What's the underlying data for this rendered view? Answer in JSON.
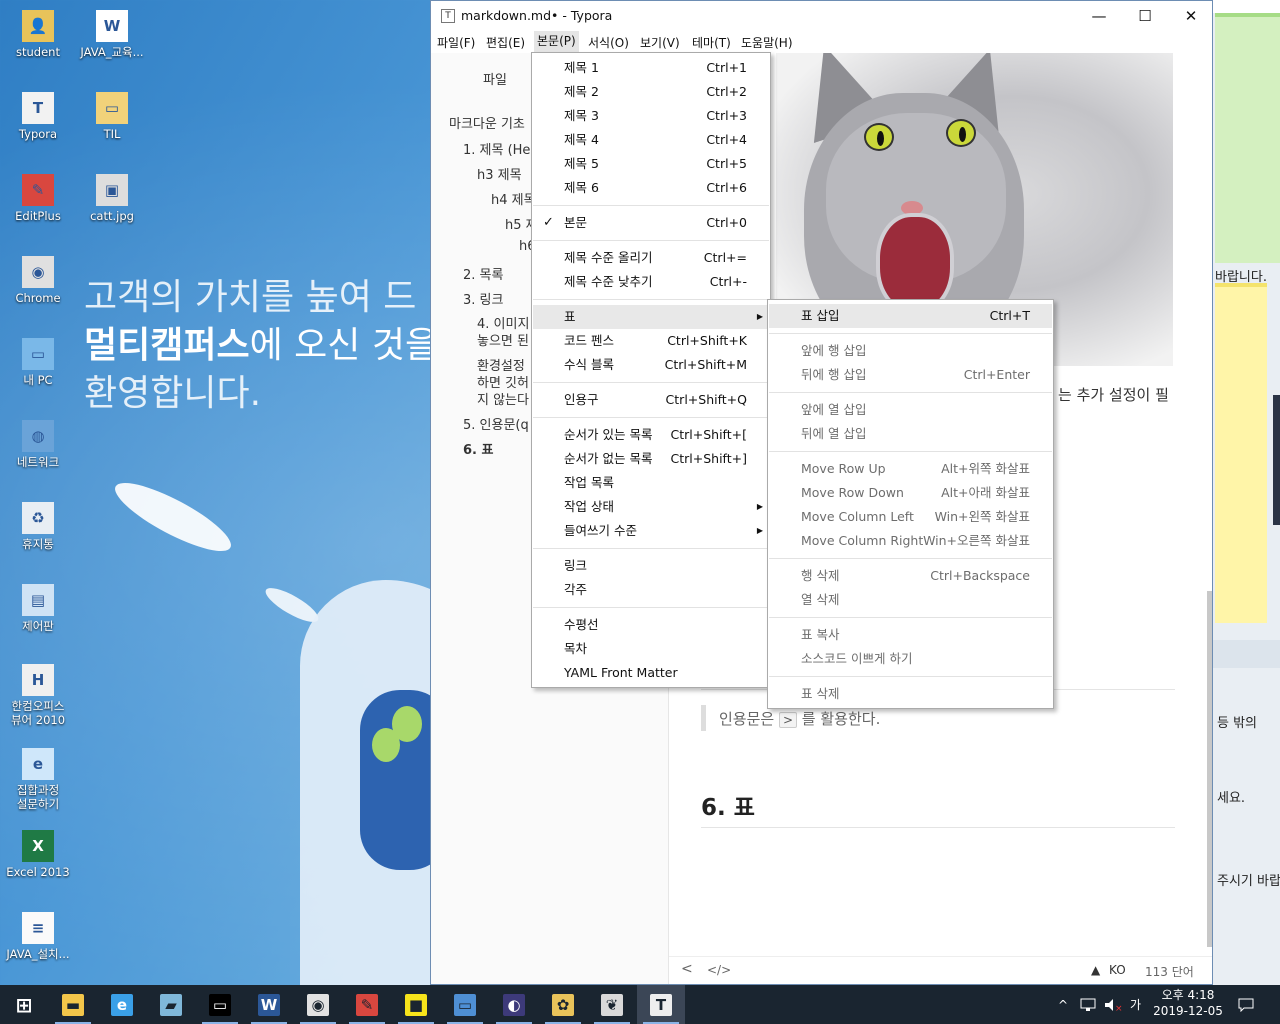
{
  "desktop": {
    "wallpaper_lines": {
      "line1": "고객의 가치를 높여 드",
      "line2_bold": "멀티캠퍼스",
      "line2_rest": "에 오신 것을",
      "line3": "환영합니다."
    },
    "icons": [
      {
        "label": "student",
        "icon": "user-folder-icon"
      },
      {
        "label": "JAVA_교육...",
        "icon": "word-document-icon"
      },
      {
        "label": "Typora",
        "icon": "typora-icon"
      },
      {
        "label": "TIL",
        "icon": "folder-icon"
      },
      {
        "label": "EditPlus",
        "icon": "editplus-icon"
      },
      {
        "label": "catt.jpg",
        "icon": "image-file-icon"
      },
      {
        "label": "Chrome",
        "icon": "chrome-icon"
      },
      {
        "label": "내 PC",
        "icon": "computer-icon"
      },
      {
        "label": "네트워크",
        "icon": "network-icon"
      },
      {
        "label": "휴지통",
        "icon": "recycle-bin-icon"
      },
      {
        "label": "제어판",
        "icon": "control-panel-icon"
      },
      {
        "label": "한컴오피스\n뷰어 2010",
        "icon": "hancom-viewer-icon"
      },
      {
        "label": "집합과정\n설문하기",
        "icon": "internet-explorer-icon"
      },
      {
        "label": "Excel 2013",
        "icon": "excel-icon"
      },
      {
        "label": "JAVA_설치...",
        "icon": "text-file-icon"
      }
    ]
  },
  "window": {
    "title": "markdown.md• - Typora",
    "controls": {
      "minimize": "—",
      "maximize": "☐",
      "close": "✕"
    },
    "menubar": [
      "파일(F)",
      "편집(E)",
      "본문(P)",
      "서식(O)",
      "보기(V)",
      "테마(T)",
      "도움말(H)"
    ],
    "active_menu": "본문(P)"
  },
  "sidebar": {
    "tab": "파일",
    "outline": [
      {
        "text": "마크다운 기초",
        "level": 0
      },
      {
        "text": "1. 제목 (He",
        "level": 1
      },
      {
        "text": "h3 제목",
        "level": 2
      },
      {
        "text": "h4 제목",
        "level": 3
      },
      {
        "text": "h5 제",
        "level": 4
      },
      {
        "text": "h6",
        "level": 5
      },
      {
        "text": "2. 목록",
        "level": 1
      },
      {
        "text": "3. 링크",
        "level": 1
      },
      {
        "text": "4. 이미지",
        "level": 2
      },
      {
        "text": "놓으면 된",
        "level": 2
      },
      {
        "text": "환경설정",
        "level": 2
      },
      {
        "text": "하면 깃허",
        "level": 2
      },
      {
        "text": "지 않는다",
        "level": 2
      },
      {
        "text": "5. 인용문(q",
        "level": 1
      },
      {
        "text": "6. 표",
        "level": 1,
        "active": true
      }
    ]
  },
  "content": {
    "partial_sentence": "는 추가 설정이 필",
    "quote_before": "인용문은 ",
    "quote_kbd": ">",
    "quote_after": " 를 활용한다.",
    "heading6": "6. 표"
  },
  "statusbar": {
    "back": "<",
    "source_toggle": "</>",
    "warning": "▲",
    "lang": "KO",
    "wordcount": "113 단어"
  },
  "paragraph_menu": {
    "items": [
      {
        "label": "제목 1",
        "shortcut": "Ctrl+1"
      },
      {
        "label": "제목 2",
        "shortcut": "Ctrl+2"
      },
      {
        "label": "제목 3",
        "shortcut": "Ctrl+3"
      },
      {
        "label": "제목 4",
        "shortcut": "Ctrl+4"
      },
      {
        "label": "제목 5",
        "shortcut": "Ctrl+5"
      },
      {
        "label": "제목 6",
        "shortcut": "Ctrl+6"
      },
      {
        "sep": true
      },
      {
        "label": "본문",
        "shortcut": "Ctrl+0",
        "checked": true
      },
      {
        "sep": true
      },
      {
        "label": "제목 수준 올리기",
        "shortcut": "Ctrl+="
      },
      {
        "label": "제목 수준 낮추기",
        "shortcut": "Ctrl+-"
      },
      {
        "sep": true
      },
      {
        "label": "표",
        "shortcut": "",
        "submenu": true,
        "highlight": true
      },
      {
        "label": "코드 펜스",
        "shortcut": "Ctrl+Shift+K"
      },
      {
        "label": "수식 블록",
        "shortcut": "Ctrl+Shift+M"
      },
      {
        "sep": true
      },
      {
        "label": "인용구",
        "shortcut": "Ctrl+Shift+Q"
      },
      {
        "sep": true
      },
      {
        "label": "순서가 있는 목록",
        "shortcut": "Ctrl+Shift+["
      },
      {
        "label": "순서가 없는 목록",
        "shortcut": "Ctrl+Shift+]"
      },
      {
        "label": "작업 목록",
        "shortcut": ""
      },
      {
        "label": "작업 상태",
        "shortcut": "",
        "submenu": true
      },
      {
        "label": "들여쓰기 수준",
        "shortcut": "",
        "submenu": true
      },
      {
        "sep": true
      },
      {
        "label": "링크",
        "shortcut": ""
      },
      {
        "label": "각주",
        "shortcut": ""
      },
      {
        "sep": true
      },
      {
        "label": "수평선",
        "shortcut": ""
      },
      {
        "label": "목차",
        "shortcut": ""
      },
      {
        "label": "YAML Front Matter",
        "shortcut": ""
      }
    ]
  },
  "table_submenu": {
    "items": [
      {
        "label": "표 삽입",
        "shortcut": "Ctrl+T",
        "enabled": true,
        "highlight": true
      },
      {
        "sep": true
      },
      {
        "label": "앞에 행 삽입",
        "shortcut": ""
      },
      {
        "label": "뒤에 행 삽입",
        "shortcut": "Ctrl+Enter"
      },
      {
        "sep": true
      },
      {
        "label": "앞에 열 삽입",
        "shortcut": ""
      },
      {
        "label": "뒤에 열 삽입",
        "shortcut": ""
      },
      {
        "sep": true
      },
      {
        "label": "Move Row Up",
        "shortcut": "Alt+위쪽 화살표"
      },
      {
        "label": "Move Row Down",
        "shortcut": "Alt+아래 화살표"
      },
      {
        "label": "Move Column Left",
        "shortcut": "Win+왼쪽 화살표"
      },
      {
        "label": "Move Column Right",
        "shortcut": "Win+오른쪽 화살표"
      },
      {
        "sep": true
      },
      {
        "label": "행 삭제",
        "shortcut": "Ctrl+Backspace"
      },
      {
        "label": "열 삭제",
        "shortcut": ""
      },
      {
        "sep": true
      },
      {
        "label": "표 복사",
        "shortcut": ""
      },
      {
        "label": "소스코드 이쁘게 하기",
        "shortcut": ""
      },
      {
        "sep": true
      },
      {
        "label": "표 삭제",
        "shortcut": ""
      }
    ]
  },
  "right_window": {
    "snippets": [
      "바랍니다.",
      "등 밖의",
      "세요.",
      "주시기 바랍니"
    ]
  },
  "taskbar": {
    "apps": [
      "start-icon",
      "file-explorer-icon",
      "internet-explorer-icon",
      "notebook-icon",
      "terminal-icon",
      "word-icon",
      "chrome-icon",
      "editplus-icon",
      "sticky-notes-icon",
      "remote-desktop-icon",
      "eclipse-icon",
      "paint-icon",
      "paint3d-icon",
      "typora-icon"
    ],
    "tray": {
      "chevron": "^",
      "ime": "가",
      "time": "오후 4:18",
      "date": "2019-12-05"
    }
  }
}
